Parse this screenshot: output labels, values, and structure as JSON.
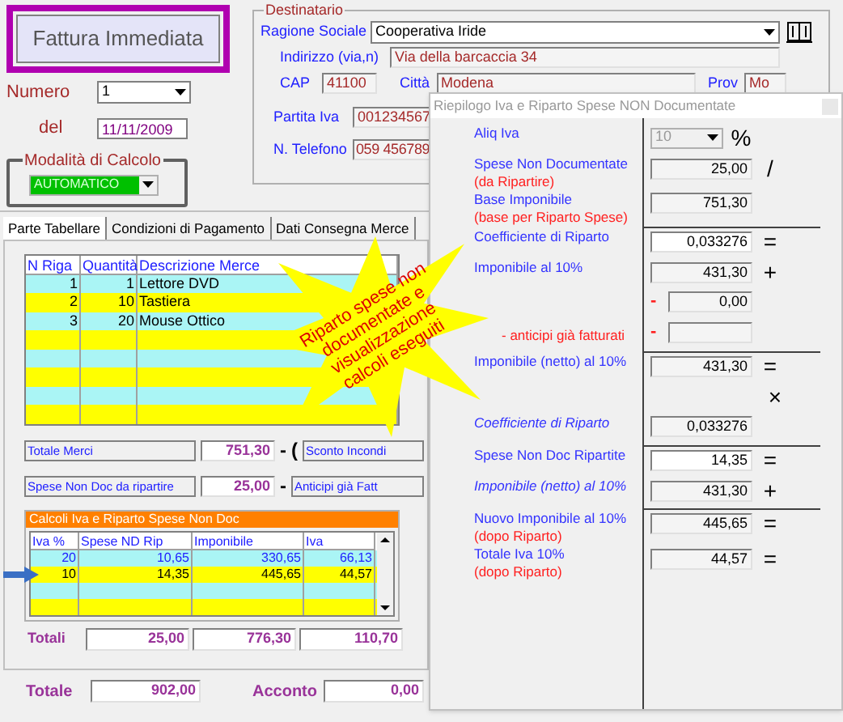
{
  "header": {
    "title": "Fattura Immediata",
    "numero_label": "Numero",
    "numero_value": "1",
    "date_label": "del",
    "date_value": "11/11/2009",
    "mode_legend": "Modalità di Calcolo",
    "mode_value": "AUTOMATICO"
  },
  "destinatario": {
    "legend": "Destinatario",
    "ragione_label": "Ragione Sociale",
    "ragione_value": "Cooperativa Iride",
    "indirizzo_label": "Indirizzo (via,n)",
    "indirizzo_value": "Via della barcaccia 34",
    "cap_label": "CAP",
    "cap_value": "41100",
    "citta_label": "Città",
    "citta_value": "Modena",
    "prov_label": "Prov",
    "prov_value": "Mo",
    "piva_label": "Partita Iva",
    "piva_value": "001234567",
    "tel_label": "N. Telefono",
    "tel_value": "059 456789"
  },
  "tabs": [
    {
      "label": "Parte Tabellare",
      "selected": true
    },
    {
      "label": "Condizioni di Pagamento",
      "selected": false
    },
    {
      "label": "Dati Consegna Merce",
      "selected": false
    }
  ],
  "items": {
    "columns": [
      "N Riga",
      "Quantità",
      "Descrizione Merce"
    ],
    "rows": [
      {
        "cells": [
          "1",
          "1",
          "Lettore DVD"
        ]
      },
      {
        "cells": [
          "2",
          "10",
          "Tastiera"
        ]
      },
      {
        "cells": [
          "3",
          "20",
          "Mouse Ottico"
        ]
      }
    ]
  },
  "summary": [
    {
      "label": "Totale Merci",
      "value": "751,30",
      "ops": [
        "-",
        "("
      ],
      "next_label": "Sconto Incondi"
    },
    {
      "label": "Spese Non Doc da ripartire",
      "value": "25,00",
      "ops": [
        "-"
      ],
      "next_label": "Anticipi già Fatt"
    }
  ],
  "iva": {
    "title": "Calcoli Iva e Riparto Spese Non Doc",
    "columns": [
      "Iva %",
      "Spese ND Rip",
      "Imponibile",
      "Iva"
    ],
    "rows": [
      {
        "cells": [
          "20",
          "10,65",
          "330,65",
          "66,13"
        ],
        "selected": false
      },
      {
        "cells": [
          "10",
          "14,35",
          "445,65",
          "44,57"
        ],
        "selected": true
      }
    ],
    "totals_label": "Totali",
    "totals": [
      "25,00",
      "776,30",
      "110,70"
    ]
  },
  "footer": {
    "totale_label": "Totale",
    "totale_value": "902,00",
    "acconto_label": "Acconto",
    "acconto_value": "0,00"
  },
  "callout": "Riparto spese non documentate e visualizzazione calcoli eseguiti",
  "dialog": {
    "title": "Riepilogo Iva e Riparto Spese NON Documentate",
    "rows": [
      {
        "kind": "select",
        "label": "Aliq Iva",
        "value": "10",
        "disabled": true,
        "op": "%"
      },
      {
        "kind": "readonly",
        "label": "Spese Non Documentate",
        "note": "(da Ripartire)",
        "value": "25,00",
        "op": "/"
      },
      {
        "kind": "readonly",
        "label": "Base Imponibile",
        "note": "(base per Riparto Spese)",
        "value": "751,30",
        "rule": true
      },
      {
        "kind": "input",
        "label": "Coefficiente di  Riparto",
        "value": "0,033276",
        "op": "="
      },
      {
        "kind": "readonly",
        "label": "Imponibile al 10%",
        "value": "431,30",
        "op": "+"
      },
      {
        "kind": "readonly",
        "prefix": "-",
        "value": "0,00"
      },
      {
        "kind": "readonly",
        "note": "- anticipi già fatturati",
        "prefix": "-",
        "rule": true
      },
      {
        "kind": "readonly",
        "label": "Imponibile (netto) al 10%",
        "value": "431,30",
        "op": "="
      },
      {
        "kind": "symbol",
        "op": "×"
      },
      {
        "kind": "readonly",
        "label": "Coefficiente di  Riparto",
        "italic": true,
        "value": "0,033276",
        "rule": true
      },
      {
        "kind": "input",
        "label": "Spese Non Doc Ripartite",
        "value": "14,35",
        "op": "="
      },
      {
        "kind": "readonly",
        "label": "Imponibile (netto) al 10%",
        "italic": true,
        "value": "431,30",
        "op": "+",
        "rule": true
      },
      {
        "kind": "readonly",
        "label": "Nuovo Imponibile al 10%",
        "note": "(dopo Riparto)",
        "value": "445,65",
        "op": "="
      },
      {
        "kind": "readonly",
        "label": "Totale Iva 10%",
        "note": "(dopo Riparto)",
        "value": "44,57",
        "op": "="
      }
    ]
  }
}
